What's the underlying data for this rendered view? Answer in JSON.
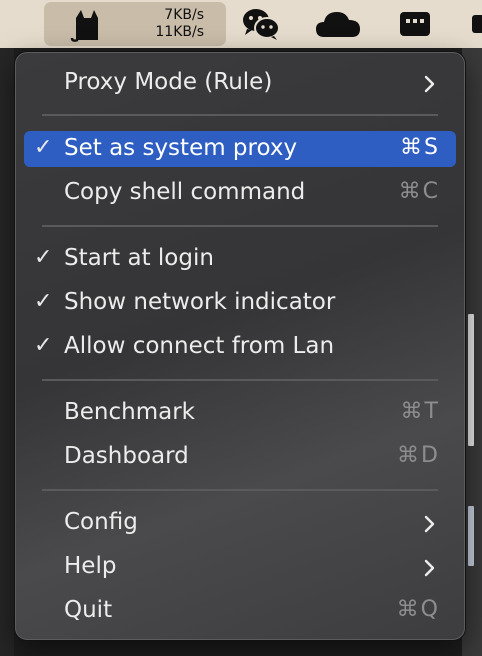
{
  "menubar": {
    "clash": {
      "icon": "cat-icon",
      "upload_speed": "7KB/s",
      "download_speed": "11KB/s"
    },
    "icons": [
      "wechat-icon",
      "cloud-icon",
      "menu-dots-icon",
      "partial-icon"
    ]
  },
  "menu": {
    "proxy_mode": {
      "label": "Proxy Mode (Rule)"
    },
    "set_system_proxy": {
      "label": "Set as system proxy",
      "checked": true,
      "shortcut": "⌘S"
    },
    "copy_shell": {
      "label": "Copy shell command",
      "shortcut": "⌘C"
    },
    "start_login": {
      "label": "Start at login",
      "checked": true
    },
    "network_indicator": {
      "label": "Show network indicator",
      "checked": true
    },
    "allow_lan": {
      "label": "Allow connect from Lan",
      "checked": true
    },
    "benchmark": {
      "label": "Benchmark",
      "shortcut": "⌘T"
    },
    "dashboard": {
      "label": "Dashboard",
      "shortcut": "⌘D"
    },
    "config": {
      "label": "Config"
    },
    "help": {
      "label": "Help"
    },
    "quit": {
      "label": "Quit",
      "shortcut": "⌘Q"
    },
    "check_glyph": "✓"
  },
  "colors": {
    "highlight": "#2e5ec2",
    "menubar": "#e6dccd"
  }
}
